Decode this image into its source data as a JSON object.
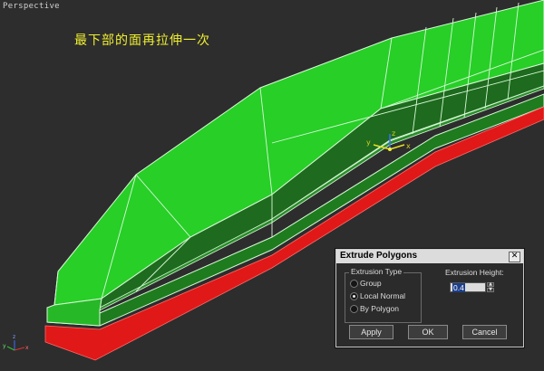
{
  "viewport": {
    "label": "Perspective"
  },
  "annotation": {
    "text": "最下部的面再拉伸一次"
  },
  "gizmo": {
    "x": "x",
    "y": "y",
    "z": "z"
  },
  "corner_axis": {
    "x": "x",
    "y": "y",
    "z": "z"
  },
  "dialog": {
    "title": "Extrude Polygons",
    "close": "✕",
    "extrusion_type": {
      "title": "Extrusion Type",
      "options": [
        "Group",
        "Local Normal",
        "By Polygon"
      ],
      "selected": "Local Normal"
    },
    "height": {
      "label": "Extrusion Height:",
      "value": "0.4"
    },
    "buttons": {
      "apply": "Apply",
      "ok": "OK",
      "cancel": "Cancel"
    }
  },
  "colors": {
    "viewport_bg": "#2d2d2d",
    "model_top": "#27cf27",
    "model_side": "#1e6a1e",
    "extruded_face": "#e01818",
    "annotation": "#f0f030",
    "dialog_bg": "#2b2b2b",
    "selection_highlight": "#1d3f8a"
  }
}
